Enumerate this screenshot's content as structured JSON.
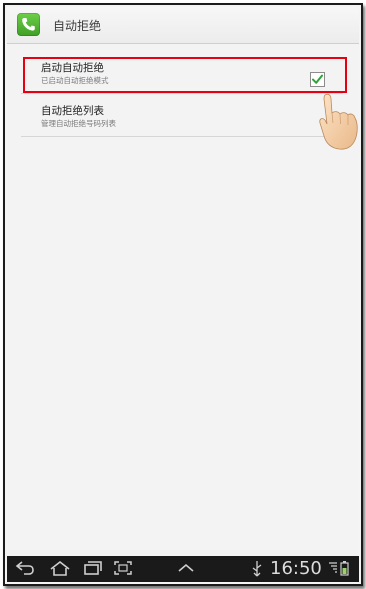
{
  "header": {
    "title": "自动拒绝",
    "icon": "phone-icon"
  },
  "settings": [
    {
      "title": "启动自动拒绝",
      "subtitle": "已启动自动拒绝模式",
      "checked": true
    },
    {
      "title": "自动拒绝列表",
      "subtitle": "管理自动拒绝号码列表"
    }
  ],
  "status_bar": {
    "time": "16:50"
  },
  "colors": {
    "highlight": "#e60012",
    "check": "#2fa33a",
    "app_icon": "#4fb535"
  }
}
